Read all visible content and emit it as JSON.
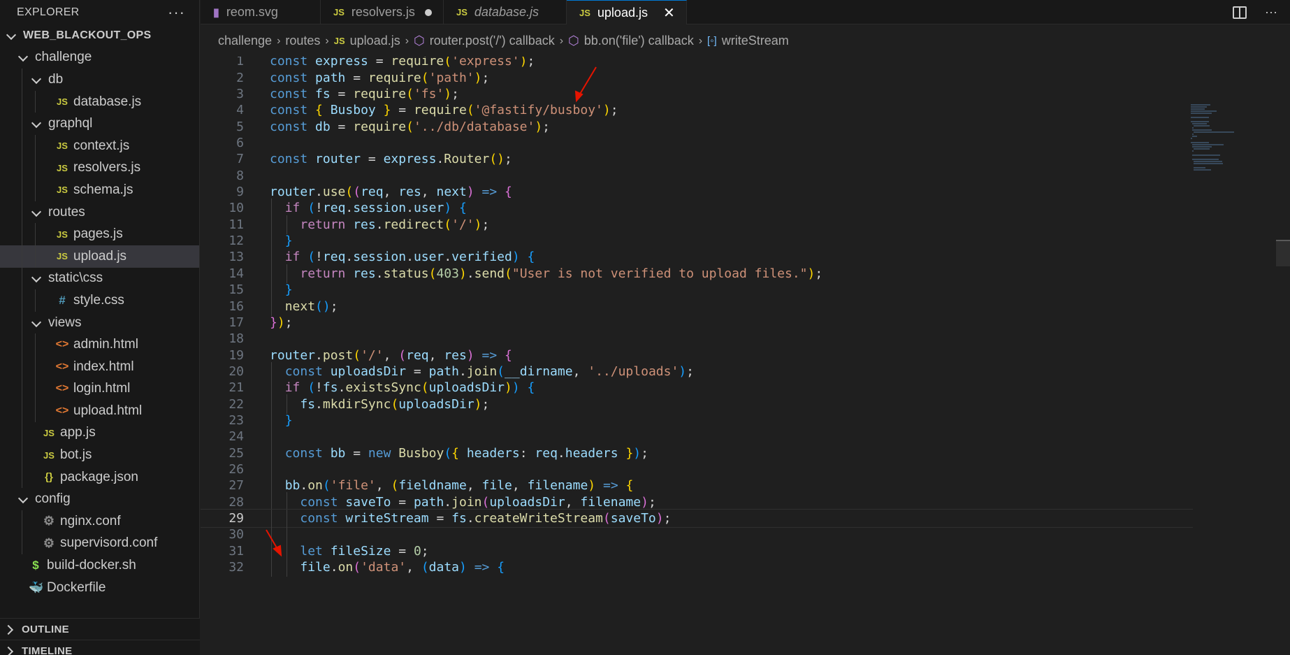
{
  "sidebar": {
    "title": "EXPLORER",
    "more_label": "···",
    "root": "WEB_BLACKOUT_OPS",
    "items": [
      {
        "label": "challenge",
        "kind": "folder"
      },
      {
        "label": "db",
        "kind": "folder"
      },
      {
        "label": "database.js",
        "kind": "js"
      },
      {
        "label": "graphql",
        "kind": "folder"
      },
      {
        "label": "context.js",
        "kind": "js"
      },
      {
        "label": "resolvers.js",
        "kind": "js"
      },
      {
        "label": "schema.js",
        "kind": "js"
      },
      {
        "label": "routes",
        "kind": "folder"
      },
      {
        "label": "pages.js",
        "kind": "js"
      },
      {
        "label": "upload.js",
        "kind": "js"
      },
      {
        "label": "static\\css",
        "kind": "folder"
      },
      {
        "label": "style.css",
        "kind": "css"
      },
      {
        "label": "views",
        "kind": "folder"
      },
      {
        "label": "admin.html",
        "kind": "html"
      },
      {
        "label": "index.html",
        "kind": "html"
      },
      {
        "label": "login.html",
        "kind": "html"
      },
      {
        "label": "upload.html",
        "kind": "html"
      },
      {
        "label": "app.js",
        "kind": "js"
      },
      {
        "label": "bot.js",
        "kind": "js"
      },
      {
        "label": "package.json",
        "kind": "json"
      },
      {
        "label": "config",
        "kind": "folder"
      },
      {
        "label": "nginx.conf",
        "kind": "gear"
      },
      {
        "label": "supervisord.conf",
        "kind": "gear"
      },
      {
        "label": "build-docker.sh",
        "kind": "sh"
      },
      {
        "label": "Dockerfile",
        "kind": "docker"
      }
    ],
    "outline_label": "OUTLINE",
    "timeline_label": "TIMELINE"
  },
  "icons": {
    "js": "JS",
    "html": "<>",
    "css": "#",
    "json": "{}",
    "gear": "⚙",
    "sh": "$",
    "docker": "🐳"
  },
  "tabs": [
    {
      "label": "reom.svg"
    },
    {
      "label": "resolvers.js"
    },
    {
      "label": "database.js"
    },
    {
      "label": "upload.js"
    }
  ],
  "breadcrumb": {
    "items": [
      "challenge",
      "routes",
      "upload.js",
      "router.post('/') callback",
      "bb.on('file') callback",
      "writeStream"
    ]
  },
  "editor": {
    "current_line": 29,
    "lines": [
      [
        [
          "kw",
          "const "
        ],
        [
          "var",
          "express"
        ],
        [
          "pun",
          " = "
        ],
        [
          "fn",
          "require"
        ],
        [
          "b1",
          "("
        ],
        [
          "str",
          "'express'"
        ],
        [
          "b1",
          ")"
        ],
        [
          "pun",
          ";"
        ]
      ],
      [
        [
          "kw",
          "const "
        ],
        [
          "var",
          "path"
        ],
        [
          "pun",
          " = "
        ],
        [
          "fn",
          "require"
        ],
        [
          "b1",
          "("
        ],
        [
          "str",
          "'path'"
        ],
        [
          "b1",
          ")"
        ],
        [
          "pun",
          ";"
        ]
      ],
      [
        [
          "kw",
          "const "
        ],
        [
          "var",
          "fs"
        ],
        [
          "pun",
          " = "
        ],
        [
          "fn",
          "require"
        ],
        [
          "b1",
          "("
        ],
        [
          "str",
          "'fs'"
        ],
        [
          "b1",
          ")"
        ],
        [
          "pun",
          ";"
        ]
      ],
      [
        [
          "kw",
          "const "
        ],
        [
          "b1",
          "{ "
        ],
        [
          "var",
          "Busboy"
        ],
        [
          "b1",
          " }"
        ],
        [
          "pun",
          " = "
        ],
        [
          "fn",
          "require"
        ],
        [
          "b1",
          "("
        ],
        [
          "str",
          "'@fastify/busboy'"
        ],
        [
          "b1",
          ")"
        ],
        [
          "pun",
          ";"
        ]
      ],
      [
        [
          "kw",
          "const "
        ],
        [
          "var",
          "db"
        ],
        [
          "pun",
          " = "
        ],
        [
          "fn",
          "require"
        ],
        [
          "b1",
          "("
        ],
        [
          "str",
          "'../db/database'"
        ],
        [
          "b1",
          ")"
        ],
        [
          "pun",
          ";"
        ]
      ],
      [],
      [
        [
          "kw",
          "const "
        ],
        [
          "var",
          "router"
        ],
        [
          "pun",
          " = "
        ],
        [
          "var",
          "express"
        ],
        [
          "pun",
          "."
        ],
        [
          "fn",
          "Router"
        ],
        [
          "b1",
          "()"
        ],
        [
          "pun",
          ";"
        ]
      ],
      [],
      [
        [
          "var",
          "router"
        ],
        [
          "pun",
          "."
        ],
        [
          "fn",
          "use"
        ],
        [
          "b1",
          "("
        ],
        [
          "b2",
          "("
        ],
        [
          "var",
          "req"
        ],
        [
          "pun",
          ", "
        ],
        [
          "var",
          "res"
        ],
        [
          "pun",
          ", "
        ],
        [
          "var",
          "next"
        ],
        [
          "b2",
          ")"
        ],
        [
          "kw",
          " => "
        ],
        [
          "b2",
          "{"
        ]
      ],
      [
        [
          "pun",
          "  "
        ],
        [
          "ctl",
          "if "
        ],
        [
          "b3",
          "("
        ],
        [
          "pun",
          "!"
        ],
        [
          "var",
          "req"
        ],
        [
          "pun",
          "."
        ],
        [
          "var",
          "session"
        ],
        [
          "pun",
          "."
        ],
        [
          "var",
          "user"
        ],
        [
          "b3",
          ")"
        ],
        [
          "b3",
          " {"
        ]
      ],
      [
        [
          "pun",
          "    "
        ],
        [
          "ctl",
          "return "
        ],
        [
          "var",
          "res"
        ],
        [
          "pun",
          "."
        ],
        [
          "fn",
          "redirect"
        ],
        [
          "b1",
          "("
        ],
        [
          "str",
          "'/'"
        ],
        [
          "b1",
          ")"
        ],
        [
          "pun",
          ";"
        ]
      ],
      [
        [
          "pun",
          "  "
        ],
        [
          "b3",
          "}"
        ]
      ],
      [
        [
          "pun",
          "  "
        ],
        [
          "ctl",
          "if "
        ],
        [
          "b3",
          "("
        ],
        [
          "pun",
          "!"
        ],
        [
          "var",
          "req"
        ],
        [
          "pun",
          "."
        ],
        [
          "var",
          "session"
        ],
        [
          "pun",
          "."
        ],
        [
          "var",
          "user"
        ],
        [
          "pun",
          "."
        ],
        [
          "var",
          "verified"
        ],
        [
          "b3",
          ")"
        ],
        [
          "b3",
          " {"
        ]
      ],
      [
        [
          "pun",
          "    "
        ],
        [
          "ctl",
          "return "
        ],
        [
          "var",
          "res"
        ],
        [
          "pun",
          "."
        ],
        [
          "fn",
          "status"
        ],
        [
          "b1",
          "("
        ],
        [
          "num",
          "403"
        ],
        [
          "b1",
          ")"
        ],
        [
          "pun",
          "."
        ],
        [
          "fn",
          "send"
        ],
        [
          "b1",
          "("
        ],
        [
          "str",
          "\"User is not verified to upload files.\""
        ],
        [
          "b1",
          ")"
        ],
        [
          "pun",
          ";"
        ]
      ],
      [
        [
          "pun",
          "  "
        ],
        [
          "b3",
          "}"
        ]
      ],
      [
        [
          "pun",
          "  "
        ],
        [
          "fn",
          "next"
        ],
        [
          "b3",
          "()"
        ],
        [
          "pun",
          ";"
        ]
      ],
      [
        [
          "b2",
          "}"
        ],
        [
          "b1",
          ")"
        ],
        [
          "pun",
          ";"
        ]
      ],
      [],
      [
        [
          "var",
          "router"
        ],
        [
          "pun",
          "."
        ],
        [
          "fn",
          "post"
        ],
        [
          "b1",
          "("
        ],
        [
          "str",
          "'/'"
        ],
        [
          "pun",
          ", "
        ],
        [
          "b2",
          "("
        ],
        [
          "var",
          "req"
        ],
        [
          "pun",
          ", "
        ],
        [
          "var",
          "res"
        ],
        [
          "b2",
          ")"
        ],
        [
          "kw",
          " => "
        ],
        [
          "b2",
          "{"
        ]
      ],
      [
        [
          "pun",
          "  "
        ],
        [
          "kw",
          "const "
        ],
        [
          "var",
          "uploadsDir"
        ],
        [
          "pun",
          " = "
        ],
        [
          "var",
          "path"
        ],
        [
          "pun",
          "."
        ],
        [
          "fn",
          "join"
        ],
        [
          "b3",
          "("
        ],
        [
          "var",
          "__dirname"
        ],
        [
          "pun",
          ", "
        ],
        [
          "str",
          "'../uploads'"
        ],
        [
          "b3",
          ")"
        ],
        [
          "pun",
          ";"
        ]
      ],
      [
        [
          "pun",
          "  "
        ],
        [
          "ctl",
          "if "
        ],
        [
          "b3",
          "("
        ],
        [
          "pun",
          "!"
        ],
        [
          "var",
          "fs"
        ],
        [
          "pun",
          "."
        ],
        [
          "fn",
          "existsSync"
        ],
        [
          "b1",
          "("
        ],
        [
          "var",
          "uploadsDir"
        ],
        [
          "b1",
          ")"
        ],
        [
          "b3",
          ")"
        ],
        [
          "b3",
          " {"
        ]
      ],
      [
        [
          "pun",
          "    "
        ],
        [
          "var",
          "fs"
        ],
        [
          "pun",
          "."
        ],
        [
          "fn",
          "mkdirSync"
        ],
        [
          "b1",
          "("
        ],
        [
          "var",
          "uploadsDir"
        ],
        [
          "b1",
          ")"
        ],
        [
          "pun",
          ";"
        ]
      ],
      [
        [
          "pun",
          "  "
        ],
        [
          "b3",
          "}"
        ]
      ],
      [],
      [
        [
          "pun",
          "  "
        ],
        [
          "kw",
          "const "
        ],
        [
          "var",
          "bb"
        ],
        [
          "pun",
          " = "
        ],
        [
          "kw",
          "new "
        ],
        [
          "fn",
          "Busboy"
        ],
        [
          "b3",
          "("
        ],
        [
          "b1",
          "{ "
        ],
        [
          "var",
          "headers"
        ],
        [
          "pun",
          ": "
        ],
        [
          "var",
          "req"
        ],
        [
          "pun",
          "."
        ],
        [
          "var",
          "headers"
        ],
        [
          "b1",
          " }"
        ],
        [
          "b3",
          ")"
        ],
        [
          "pun",
          ";"
        ]
      ],
      [],
      [
        [
          "pun",
          "  "
        ],
        [
          "var",
          "bb"
        ],
        [
          "pun",
          "."
        ],
        [
          "fn",
          "on"
        ],
        [
          "b3",
          "("
        ],
        [
          "str",
          "'file'"
        ],
        [
          "pun",
          ", "
        ],
        [
          "b1",
          "("
        ],
        [
          "var",
          "fieldname"
        ],
        [
          "pun",
          ", "
        ],
        [
          "var",
          "file"
        ],
        [
          "pun",
          ", "
        ],
        [
          "var",
          "filename"
        ],
        [
          "b1",
          ")"
        ],
        [
          "kw",
          " => "
        ],
        [
          "b1",
          "{"
        ]
      ],
      [
        [
          "pun",
          "    "
        ],
        [
          "kw",
          "const "
        ],
        [
          "var",
          "saveTo"
        ],
        [
          "pun",
          " = "
        ],
        [
          "var",
          "path"
        ],
        [
          "pun",
          "."
        ],
        [
          "fn",
          "join"
        ],
        [
          "b2",
          "("
        ],
        [
          "var",
          "uploadsDir"
        ],
        [
          "pun",
          ", "
        ],
        [
          "var",
          "filename"
        ],
        [
          "b2",
          ")"
        ],
        [
          "pun",
          ";"
        ]
      ],
      [
        [
          "pun",
          "    "
        ],
        [
          "kw",
          "const "
        ],
        [
          "var",
          "writeStream"
        ],
        [
          "pun",
          " = "
        ],
        [
          "var",
          "fs"
        ],
        [
          "pun",
          "."
        ],
        [
          "fn",
          "createWriteStream"
        ],
        [
          "b2",
          "("
        ],
        [
          "var",
          "saveTo"
        ],
        [
          "b2",
          ")"
        ],
        [
          "pun",
          ";"
        ]
      ],
      [],
      [
        [
          "pun",
          "    "
        ],
        [
          "kw",
          "let "
        ],
        [
          "var",
          "fileSize"
        ],
        [
          "pun",
          " = "
        ],
        [
          "num",
          "0"
        ],
        [
          "pun",
          ";"
        ]
      ],
      [
        [
          "pun",
          "    "
        ],
        [
          "var",
          "file"
        ],
        [
          "pun",
          "."
        ],
        [
          "fn",
          "on"
        ],
        [
          "b2",
          "("
        ],
        [
          "str",
          "'data'"
        ],
        [
          "pun",
          ", "
        ],
        [
          "b3",
          "("
        ],
        [
          "var",
          "data"
        ],
        [
          "b3",
          ")"
        ],
        [
          "kw",
          " => "
        ],
        [
          "b3",
          "{"
        ]
      ]
    ]
  },
  "colors": {
    "accent": "#0078d4",
    "arrow": "#e51400"
  }
}
